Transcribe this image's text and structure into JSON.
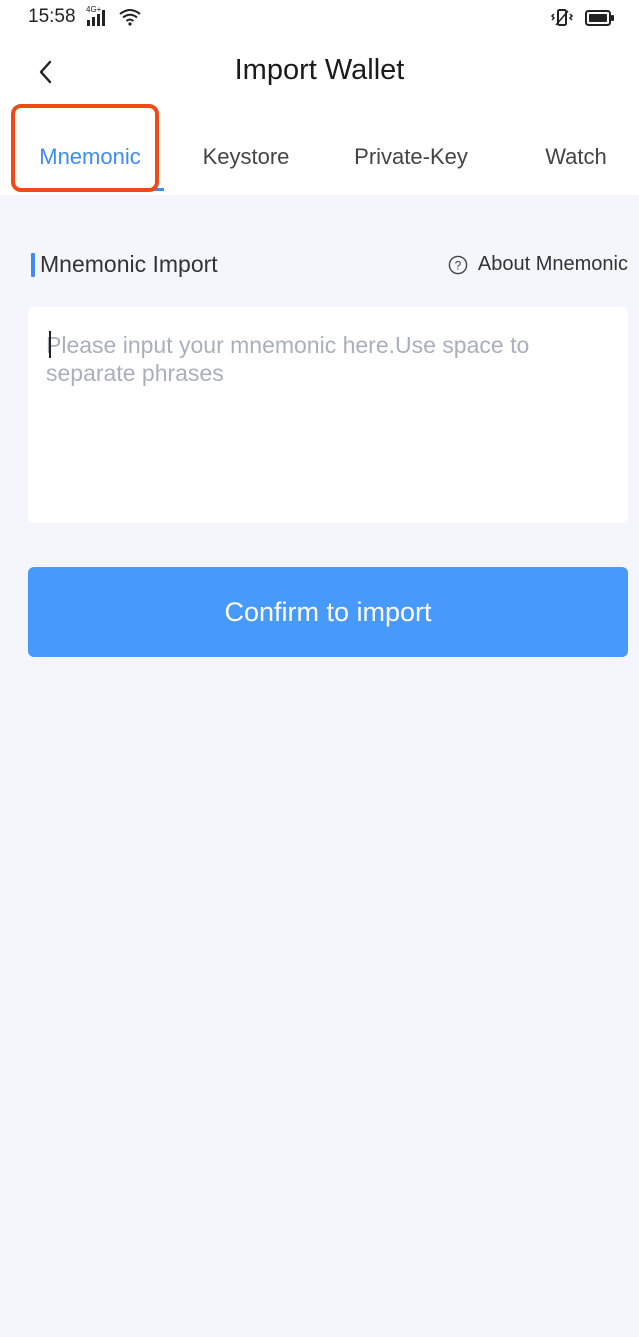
{
  "status_bar": {
    "time": "15:58",
    "network": "4G+",
    "icons": [
      "signal-icon",
      "wifi-icon",
      "vibrate-icon",
      "battery-icon"
    ]
  },
  "header": {
    "back_icon": "chevron-left-icon",
    "title": "Import Wallet"
  },
  "tabs": [
    {
      "label": "Mnemonic",
      "active": true
    },
    {
      "label": "Keystore",
      "active": false
    },
    {
      "label": "Private-Key",
      "active": false
    },
    {
      "label": "Watch",
      "active": false
    }
  ],
  "section": {
    "title": "Mnemonic Import",
    "about_label": "About Mnemonic",
    "about_icon": "help-circle-icon"
  },
  "mnemonic_input": {
    "value": "",
    "placeholder": "Please input your mnemonic here.Use space to separate phrases"
  },
  "confirm_button": {
    "label": "Confirm to import"
  },
  "colors": {
    "accent": "#3f8cf0",
    "button": "#4799fb",
    "highlight": "#f04a17",
    "background": "#f4f6fb"
  }
}
